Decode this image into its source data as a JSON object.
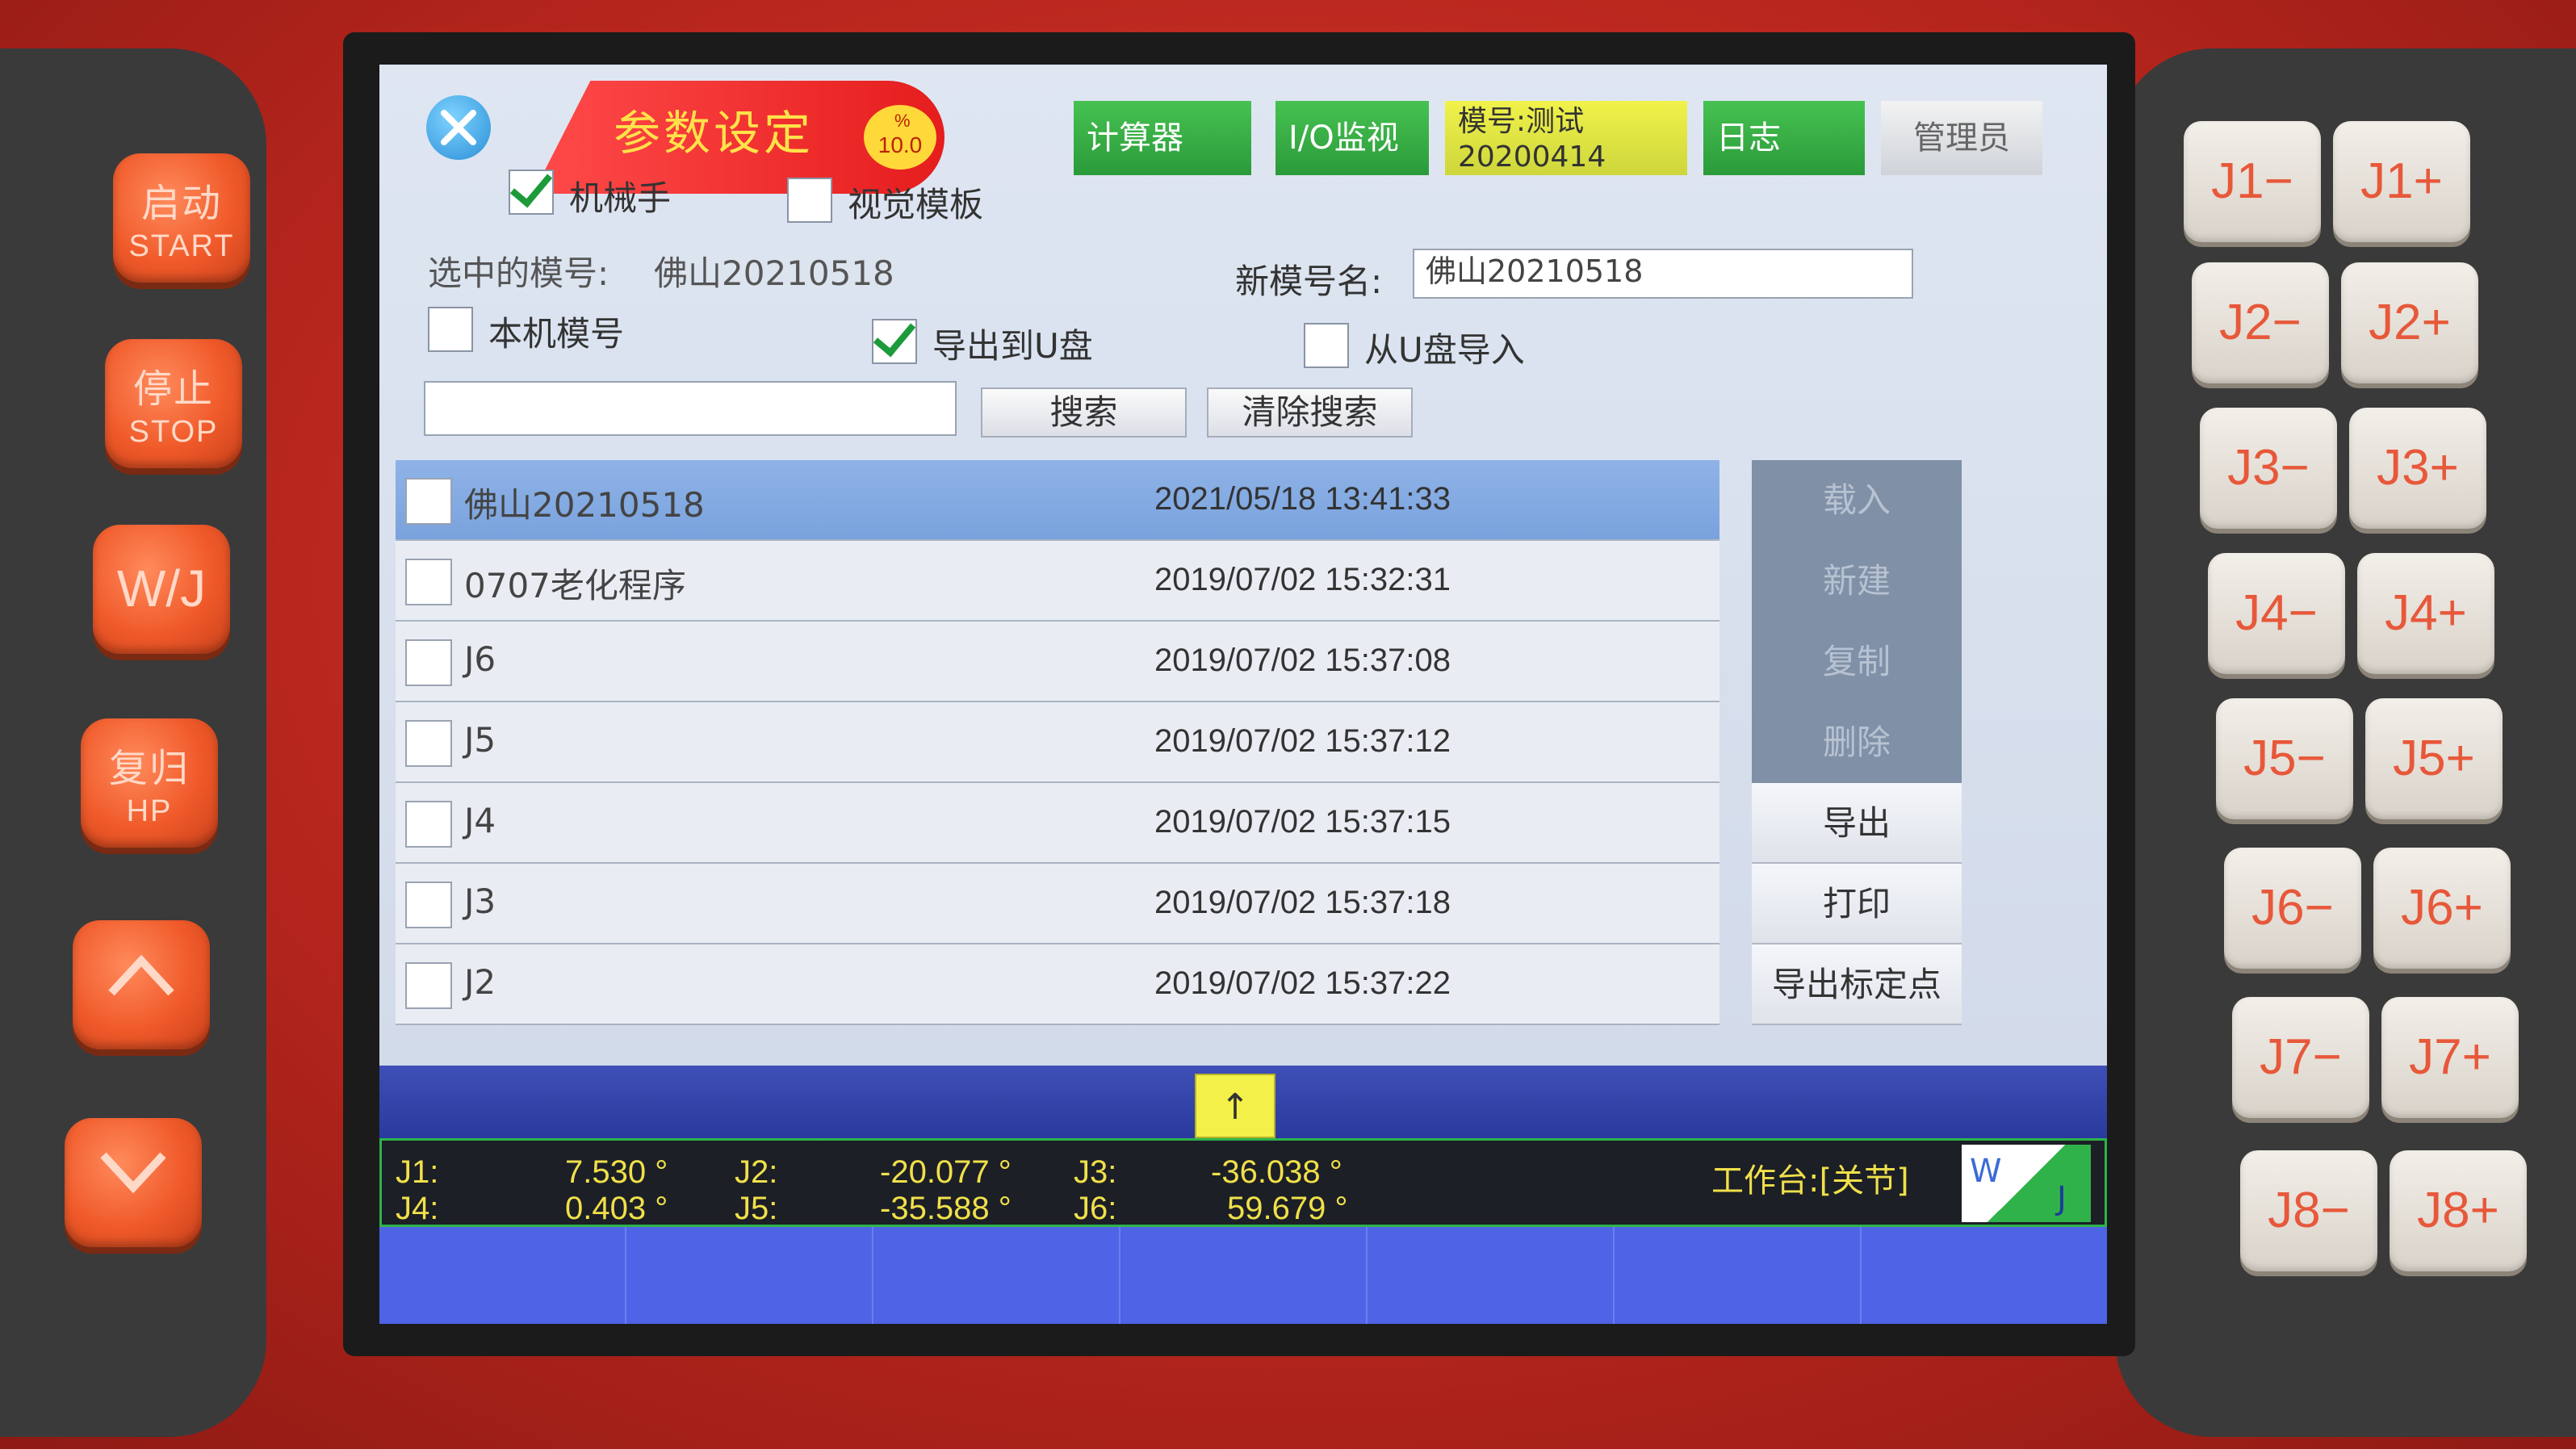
{
  "hardware": {
    "left_buttons": [
      {
        "main": "启动",
        "sub": "START"
      },
      {
        "main": "停止",
        "sub": "STOP"
      },
      {
        "main": "W/J",
        "sub": ""
      },
      {
        "main": "复归",
        "sub": "HP"
      }
    ],
    "jog_keys": [
      [
        "J1−",
        "J1+"
      ],
      [
        "J2−",
        "J2+"
      ],
      [
        "J3−",
        "J3+"
      ],
      [
        "J4−",
        "J4+"
      ],
      [
        "J5−",
        "J5+"
      ],
      [
        "J6−",
        "J6+"
      ],
      [
        "J7−",
        "J7+"
      ],
      [
        "J8−",
        "J8+"
      ]
    ]
  },
  "header": {
    "title": "参数设定",
    "speed_top": "%",
    "speed": "10.0",
    "buttons": {
      "calculator": "计算器",
      "io_monitor": "I/O监视",
      "model_line1": "模号:测试",
      "model_line2": "20200414",
      "log": "日志",
      "admin": "管理员"
    }
  },
  "tabs": {
    "robot_arm": {
      "label": "机械手",
      "checked": true
    },
    "vision_template": {
      "label": "视觉模板",
      "checked": false
    }
  },
  "form": {
    "selected_label": "选中的模号:",
    "selected_value": "佛山20210518",
    "new_name_label": "新模号名:",
    "new_name_value": "佛山20210518",
    "local_model": {
      "label": "本机模号",
      "checked": false
    },
    "export_usb": {
      "label": "导出到U盘",
      "checked": true
    },
    "import_usb": {
      "label": "从U盘导入",
      "checked": false
    },
    "search_value": "",
    "search_button": "搜索",
    "clear_search_button": "清除搜索"
  },
  "list": [
    {
      "name": "佛山20210518",
      "time": "2021/05/18 13:41:33",
      "selected": true
    },
    {
      "name": "0707老化程序",
      "time": "2019/07/02 15:32:31",
      "selected": false
    },
    {
      "name": "J6",
      "time": "2019/07/02 15:37:08",
      "selected": false
    },
    {
      "name": "J5",
      "time": "2019/07/02 15:37:12",
      "selected": false
    },
    {
      "name": "J4",
      "time": "2019/07/02 15:37:15",
      "selected": false
    },
    {
      "name": "J3",
      "time": "2019/07/02 15:37:18",
      "selected": false
    },
    {
      "name": "J2",
      "time": "2019/07/02 15:37:22",
      "selected": false
    }
  ],
  "side_menu": [
    {
      "label": "载入",
      "enabled": false
    },
    {
      "label": "新建",
      "enabled": false
    },
    {
      "label": "复制",
      "enabled": false
    },
    {
      "label": "删除",
      "enabled": false
    },
    {
      "label": "导出",
      "enabled": true
    },
    {
      "label": "打印",
      "enabled": true
    },
    {
      "label": "导出标定点",
      "enabled": true
    }
  ],
  "scroll_up": "↑",
  "coords": {
    "j1_label": "J1:",
    "j1": "7.530 °",
    "j2_label": "J2:",
    "j2": "-20.077 °",
    "j3_label": "J3:",
    "j3": "-36.038 °",
    "j4_label": "J4:",
    "j4": "0.403 °",
    "j5_label": "J5:",
    "j5": "-35.588 °",
    "j6_label": "J6:",
    "j6": "59.679 °",
    "workbench": "工作台:[关节]",
    "mode_w": "W",
    "mode_j": "J"
  }
}
